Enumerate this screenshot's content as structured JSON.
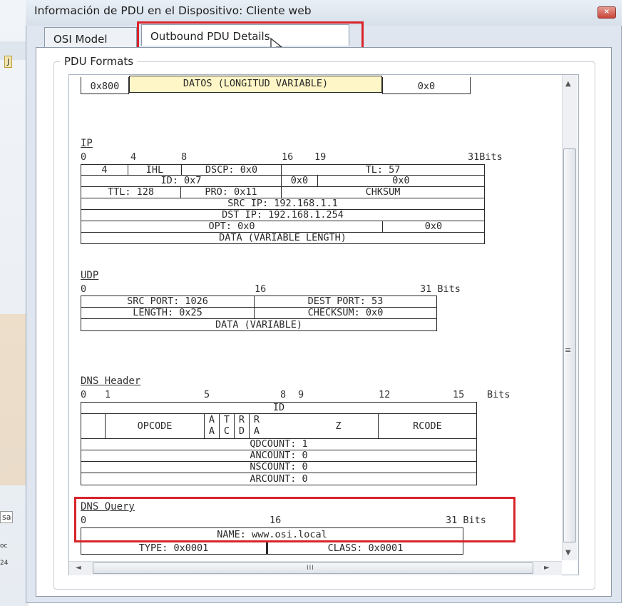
{
  "window": {
    "title": "Información de PDU en el Dispositivo: Cliente web",
    "close_label": "×"
  },
  "tabs": [
    {
      "label": "OSI Model",
      "selected": false
    },
    {
      "label": "Outbound PDU Details",
      "selected": true
    }
  ],
  "group_label": "PDU Formats",
  "ethernet": {
    "type": "0x800",
    "data": "DATOS (LONGITUD VARIABLE)",
    "fcs": "0x0"
  },
  "ip": {
    "title": "IP",
    "ruler": {
      "b0": "0",
      "b4": "4",
      "b8": "8",
      "b16": "16",
      "b19": "19",
      "b31": "31Bits"
    },
    "row1": [
      "4",
      "IHL",
      "DSCP: 0x0",
      "TL: 57"
    ],
    "row2": [
      "ID: 0x7",
      "0x0",
      "0x0"
    ],
    "row3": [
      "TTL: 128",
      "PRO: 0x11",
      "CHKSUM"
    ],
    "src": "SRC IP: 192.168.1.1",
    "dst": "DST IP: 192.168.1.254",
    "opt": [
      "OPT: 0x0",
      "0x0"
    ],
    "data": "DATA (VARIABLE LENGTH)"
  },
  "udp": {
    "title": "UDP",
    "ruler": {
      "b0": "0",
      "b16": "16",
      "b31": "31 Bits"
    },
    "row1": [
      "SRC PORT: 1026",
      "DEST PORT: 53"
    ],
    "row2": [
      "LENGTH: 0x25",
      "CHECKSUM: 0x0"
    ],
    "data": "DATA (VARIABLE)"
  },
  "dns_header": {
    "title": "DNS Header",
    "ruler": {
      "b0": "0",
      "b1": "1",
      "b5": "5",
      "b8": "8",
      "b9": "9",
      "b12": "12",
      "b15": "15",
      "bits": "Bits"
    },
    "id": "ID",
    "opcode": "OPCODE",
    "aa": [
      "A",
      "A"
    ],
    "tc": [
      "T",
      "C"
    ],
    "rd": [
      "R",
      "D"
    ],
    "ra": [
      "R",
      "A"
    ],
    "z": "Z",
    "rcode": "RCODE",
    "qdcount": "QDCOUNT: 1",
    "ancount": "ANCOUNT: 0",
    "nscount": "NSCOUNT: 0",
    "arcount": "ARCOUNT: 0"
  },
  "dns_query": {
    "title": "DNS Query",
    "ruler": {
      "b0": "0",
      "b16": "16",
      "b31": "31 Bits"
    },
    "name": "NAME: www.osi.local",
    "type": "TYPE: 0x0001",
    "class": "CLASS: 0x0001"
  },
  "scrollbar": {
    "up": "▲",
    "down": "▼",
    "left": "◄",
    "right": "►",
    "grip_v": "≡",
    "grip_h": "III"
  },
  "side_chips": [
    "J",
    "sa",
    "oc",
    "24"
  ],
  "colors": {
    "highlight": "#d8242b",
    "data_fill": "#fff6c7",
    "accent": "#f0a94a"
  }
}
